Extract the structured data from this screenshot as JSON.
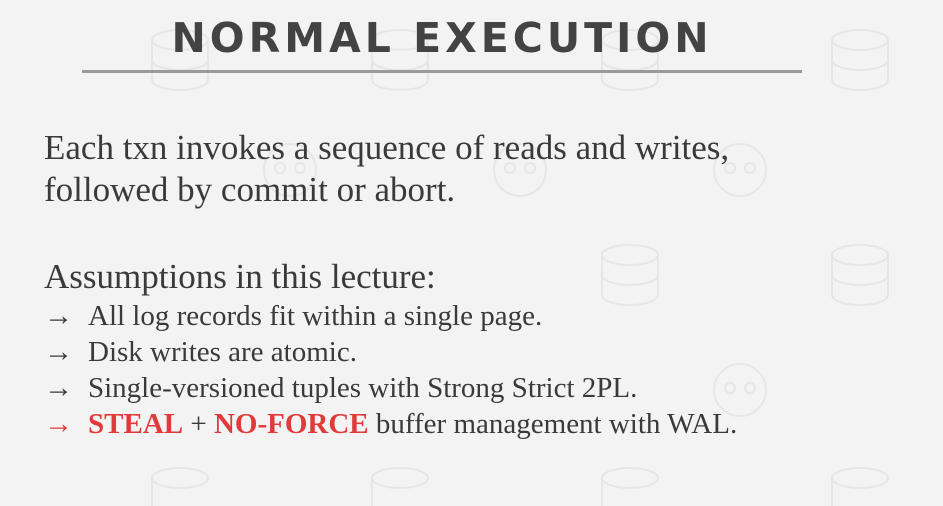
{
  "title": "NORMAL EXECUTION",
  "intro": {
    "line1": "Each txn invokes a sequence of reads and writes,",
    "line2": "followed by commit or abort."
  },
  "assumptions": {
    "heading": "Assumptions in this lecture:",
    "arrow": "→",
    "items": [
      "All log records fit within a single page.",
      "Disk writes are atomic.",
      "Single-versioned tuples with Strong Strict 2PL."
    ],
    "highlight": {
      "steal": "STEAL",
      "plus": " + ",
      "no_force": "NO-FORCE",
      "rest": " buffer management with WAL."
    }
  },
  "colors": {
    "background": "#f3f3f3",
    "text": "#3a3a3a",
    "accent": "#e03a3a",
    "rule": "#9a9a9a"
  },
  "icons": [
    "database-icon",
    "skull-icon"
  ]
}
